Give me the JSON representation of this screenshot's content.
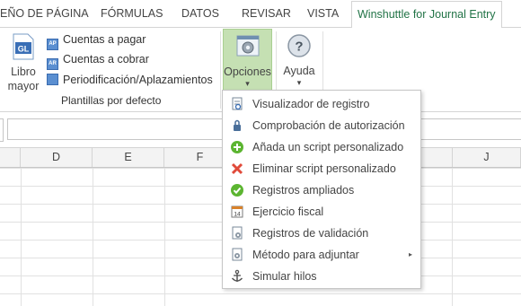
{
  "tabs": [
    "EÑO DE PÁGINA",
    "FÓRMULAS",
    "DATOS",
    "REVISAR",
    "VISTA",
    "Winshuttle for Journal Entry"
  ],
  "ribbon": {
    "libro_mayor": {
      "line1": "Libro",
      "line2": "mayor",
      "icon_text": "GL"
    },
    "items": [
      {
        "label": "Cuentas a pagar",
        "icon_text": "AP"
      },
      {
        "label": "Cuentas a cobrar",
        "icon_text": "AR"
      },
      {
        "label": "Periodificación/Aplazamientos",
        "icon_text": ""
      }
    ],
    "group_label": "Plantillas por defecto",
    "opciones": {
      "label": "Opciones",
      "dropdown": "▾"
    },
    "ayuda": {
      "label": "Ayuda",
      "dropdown": "▾",
      "icon_text": "?"
    }
  },
  "columns": [
    "D",
    "E",
    "F",
    "J"
  ],
  "menu": {
    "items": [
      {
        "label": "Visualizador de registro",
        "icon": "log-viewer-icon"
      },
      {
        "label": "Comprobación de autorización",
        "icon": "authorization-check-icon"
      },
      {
        "label": "Añada un script personalizado",
        "icon": "add-icon"
      },
      {
        "label": "Eliminar script personalizado",
        "icon": "remove-icon"
      },
      {
        "label": "Registros ampliados",
        "icon": "check-icon"
      },
      {
        "label": "Ejercicio fiscal",
        "icon": "calendar-icon"
      },
      {
        "label": "Registros de validación",
        "icon": "validation-log-icon"
      },
      {
        "label": "Método para adjuntar",
        "icon": "attach-method-icon",
        "submenu": "▸"
      },
      {
        "label": "Simular hilos",
        "icon": "anchor-icon"
      }
    ]
  },
  "colors": {
    "accent": "#217346",
    "selected_button": "#c5e0b3"
  }
}
